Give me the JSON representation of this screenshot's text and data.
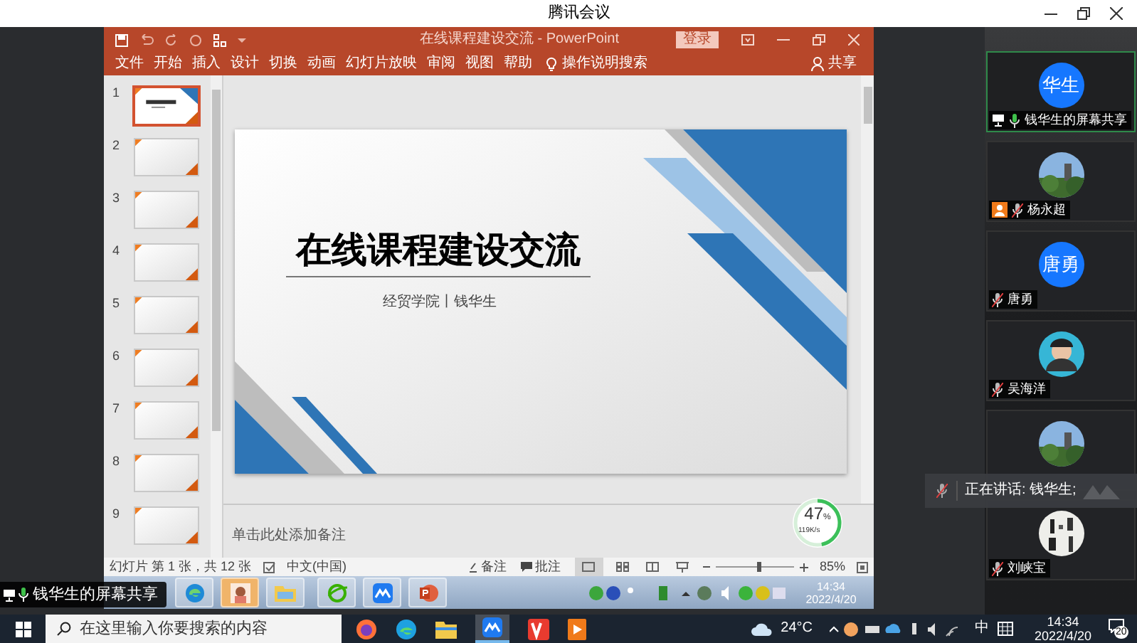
{
  "meeting_window": {
    "title": "腾讯会议"
  },
  "presentation": {
    "title": "在线课程建设交流 - PowerPoint",
    "sign_in": "登录",
    "ribbon_tabs": [
      {
        "label": "文件"
      },
      {
        "label": "开始"
      },
      {
        "label": "插入"
      },
      {
        "label": "设计"
      },
      {
        "label": "切换"
      },
      {
        "label": "动画"
      },
      {
        "label": "幻灯片放映"
      },
      {
        "label": "审阅"
      },
      {
        "label": "视图"
      },
      {
        "label": "帮助"
      }
    ],
    "tell_me": "操作说明搜索",
    "share": "共享",
    "thumbnails": [
      {
        "number": "1",
        "selected": true
      },
      {
        "number": "2",
        "selected": false
      },
      {
        "number": "3",
        "selected": false
      },
      {
        "number": "4",
        "selected": false
      },
      {
        "number": "5",
        "selected": false
      },
      {
        "number": "6",
        "selected": false
      },
      {
        "number": "7",
        "selected": false
      },
      {
        "number": "8",
        "selected": false
      },
      {
        "number": "9",
        "selected": false
      }
    ],
    "slide": {
      "title": "在线课程建设交流",
      "subtitle": "经贸学院丨钱华生"
    },
    "notes_placeholder": "单击此处添加备注",
    "status_bar": {
      "slide_info": "幻灯片 第 1 张，共 12 张",
      "language": "中文(中国)",
      "notes": "备注",
      "comments": "批注",
      "zoom": "85%",
      "level": 0.55
    }
  },
  "network_meter": {
    "percent": "47",
    "unit": "%",
    "speed": "119K/s",
    "level": 0.47
  },
  "shared_taskbar": {
    "time": "14:34",
    "date": "2022/4/20"
  },
  "share_banner": "钱华生的屏幕共享",
  "participants": [
    {
      "kind": "initials",
      "avatar_text": "华生",
      "name": "钱华生的屏幕共享",
      "muted": false,
      "sharing": true,
      "host": false,
      "selected": true
    },
    {
      "kind": "picture",
      "name": "杨永超",
      "muted": true,
      "sharing": false,
      "host": true,
      "selected": false
    },
    {
      "kind": "initials",
      "avatar_text": "唐勇",
      "name": "唐勇",
      "muted": true,
      "sharing": false,
      "host": false,
      "selected": false
    },
    {
      "kind": "silhouette",
      "name": "吴海洋",
      "muted": true,
      "sharing": false,
      "host": false,
      "selected": false
    },
    {
      "kind": "picture",
      "sharing": false,
      "host": false,
      "selected": false
    },
    {
      "kind": "picture",
      "name": "刘峡宝",
      "muted": true,
      "sharing": false,
      "host": false,
      "selected": false
    }
  ],
  "speaking_toast": {
    "text": "正在讲话: 钱华生;"
  },
  "taskbar": {
    "search_placeholder": "在这里输入你要搜索的内容",
    "weather": "24°C",
    "ime": "中",
    "time": "14:34",
    "date": "2022/4/20",
    "notifications": "20"
  }
}
